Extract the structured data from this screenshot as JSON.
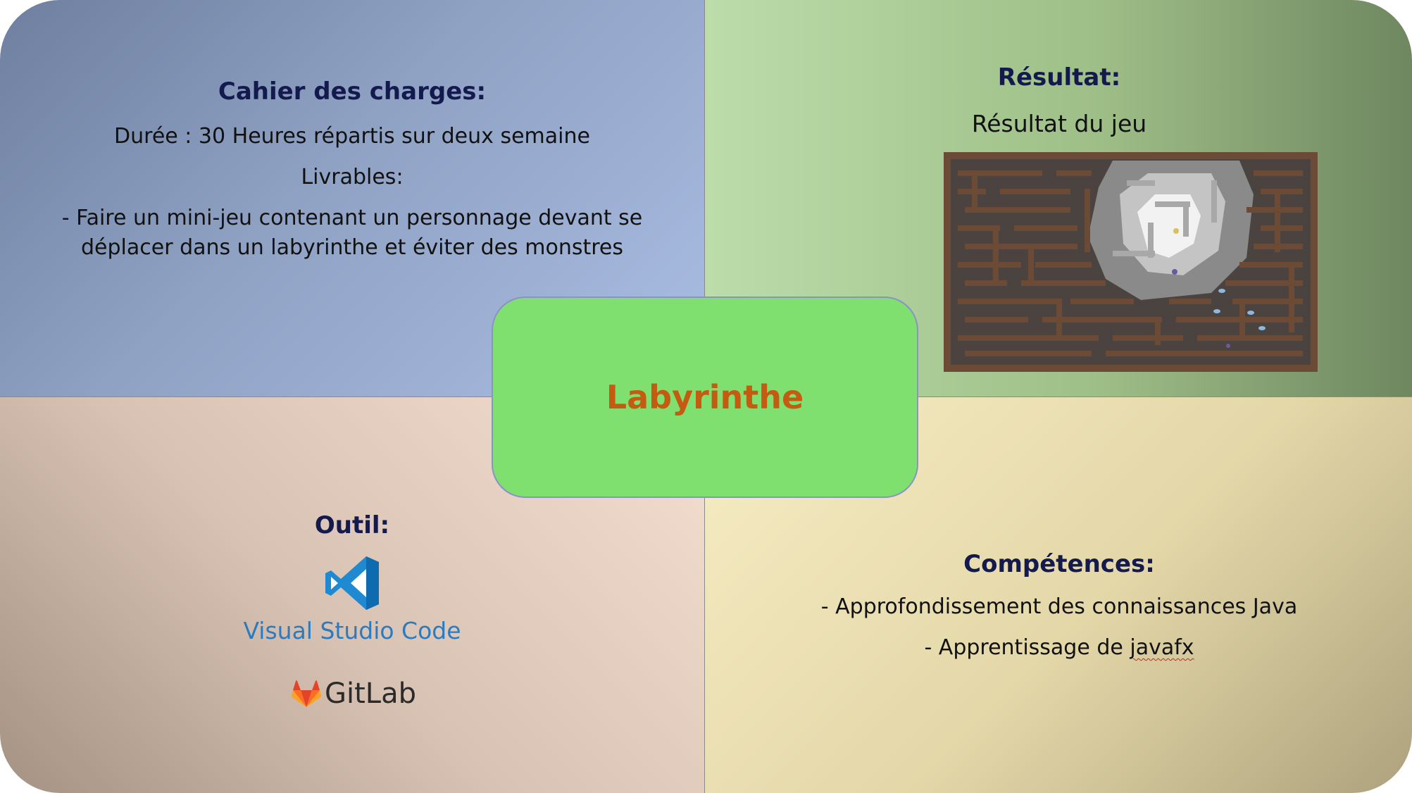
{
  "center": {
    "title": "Labyrinthe"
  },
  "cahier": {
    "heading": "Cahier des charges:",
    "duree": "Durée : 30 Heures répartis sur deux semaine",
    "livrables": "Livrables:",
    "line1": "- Faire un mini-jeu contenant un personnage devant se",
    "line2": "déplacer dans un labyrinthe et éviter des monstres"
  },
  "resultat": {
    "heading": "Résultat:",
    "caption": "Résultat du jeu"
  },
  "outil": {
    "heading": "Outil:",
    "vscode_label": "Visual Studio Code",
    "gitlab_label": "GitLab"
  },
  "competences": {
    "heading": "Compétences:",
    "line1": "- Approfondissement des connaissances Java",
    "line2_prefix": "- Apprentissage de ",
    "line2_word": "javafx"
  },
  "colors": {
    "heading": "#151a4e",
    "title_accent": "#c55a11",
    "center_box": "#7fe070",
    "vscode_blue": "#2b7bc0",
    "gitlab_orange": "#fc6d26"
  },
  "icons": [
    "vscode-logo-icon",
    "gitlab-logo-icon"
  ]
}
